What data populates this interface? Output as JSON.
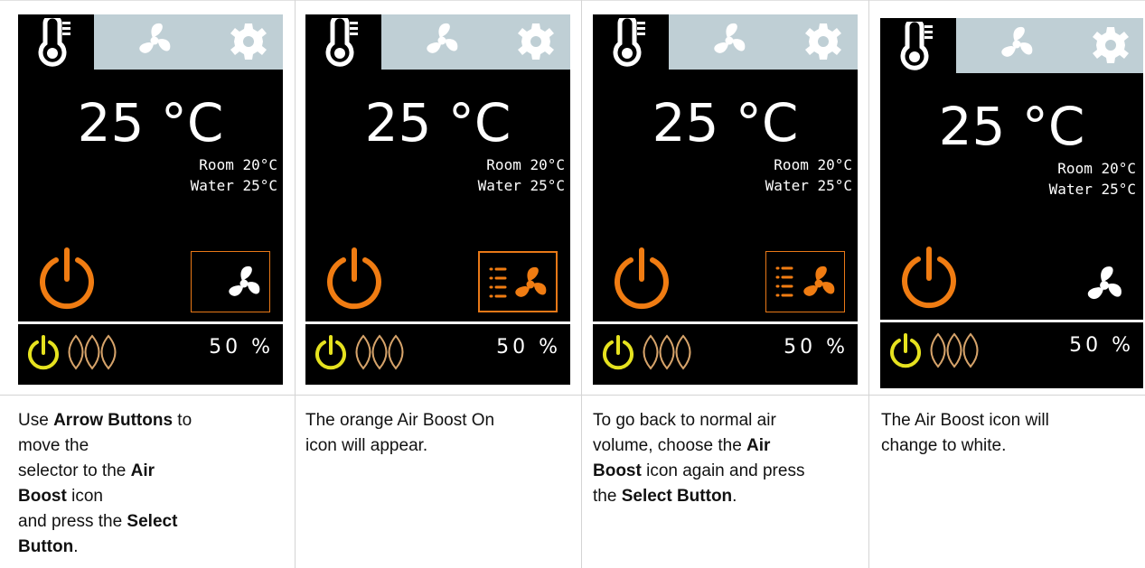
{
  "panels": [
    {
      "temperature": "25 °C",
      "room": "Room 20°C",
      "water": "Water 25°C",
      "fan_speed": "50 %",
      "air_boost_state": "selected, off",
      "air_boost_icon_color": "#ffffff",
      "selector_color": "#e87817"
    },
    {
      "temperature": "25 °C",
      "room": "Room 20°C",
      "water": "Water 25°C",
      "fan_speed": "50 %",
      "air_boost_state": "selected, on",
      "air_boost_icon_color": "#f07c12",
      "selector_color": "#e87817"
    },
    {
      "temperature": "25 °C",
      "room": "Room 20°C",
      "water": "Water 25°C",
      "fan_speed": "50 %",
      "air_boost_state": "selected, on",
      "air_boost_icon_color": "#f07c12",
      "selector_color": "#e87817"
    },
    {
      "temperature": "25 °C",
      "room": "Room 20°C",
      "water": "Water 25°C",
      "fan_speed": "50 %",
      "air_boost_state": "not selected, off",
      "air_boost_icon_color": "#ffffff",
      "selector_color": ""
    }
  ],
  "captions": [
    {
      "l1a": "Use ",
      "l1b": "Arrow Buttons",
      "l1c": " to",
      "l2": "move the",
      "l3a": "selector to the ",
      "l3b": "Air",
      "l4a": "Boost",
      "l4b": " icon",
      "l5a": "and press the ",
      "l5b": "Select",
      "l6a": "Button",
      "l6b": "."
    },
    {
      "l1": "The orange Air Boost On",
      "l2": "icon will appear."
    },
    {
      "l1": "To go back to normal air",
      "l2a": "volume, choose the ",
      "l2b": "Air",
      "l3a": "Boost",
      "l3b": " icon again and press",
      "l4a": "the ",
      "l4b": "Select Button",
      "l4c": "."
    },
    {
      "l1": "The Air Boost icon will",
      "l2": "change to white."
    }
  ],
  "icons": {
    "tab_active": "thermometer-icon",
    "tab_2": "fan-icon",
    "tab_3": "gear-icon",
    "power": "power-icon",
    "boost": "air-boost-fan-icon",
    "fan_speed": "leaf-icon"
  },
  "colors": {
    "panel_background": "#000000",
    "tab_bar": "#bfcfd5",
    "power_orange": "#f07c12",
    "power_yellow": "#e6e21f",
    "leaf_outline": "#d6a36a"
  }
}
